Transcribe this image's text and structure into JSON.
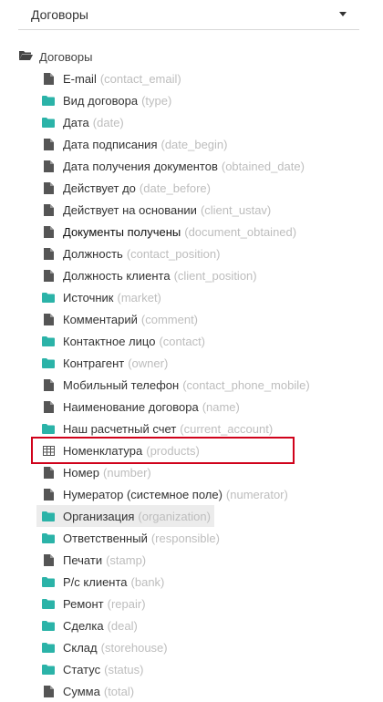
{
  "select": {
    "value": "Договоры"
  },
  "root": {
    "label": "Договоры",
    "icon": "folder-open-icon"
  },
  "items": [
    {
      "label": "E-mail",
      "code": "(contact_email)",
      "icon": "file-icon"
    },
    {
      "label": "Вид договора",
      "code": "(type)",
      "icon": "folder-icon"
    },
    {
      "label": "Дата",
      "code": "(date)",
      "icon": "folder-icon"
    },
    {
      "label": "Дата подписания",
      "code": "(date_begin)",
      "icon": "file-icon"
    },
    {
      "label": "Дата получения документов",
      "code": "(obtained_date)",
      "icon": "file-icon"
    },
    {
      "label": "Действует до",
      "code": "(date_before)",
      "icon": "file-icon"
    },
    {
      "label": "Действует на основании",
      "code": "(client_ustav)",
      "icon": "file-icon"
    },
    {
      "label": "Документы получены",
      "code": "(document_obtained)",
      "icon": "file-icon"
    },
    {
      "label": "Должность",
      "code": "(contact_position)",
      "icon": "file-icon"
    },
    {
      "label": "Должность клиента",
      "code": "(client_position)",
      "icon": "file-icon"
    },
    {
      "label": "Источник",
      "code": "(market)",
      "icon": "folder-icon"
    },
    {
      "label": "Комментарий",
      "code": "(comment)",
      "icon": "file-icon"
    },
    {
      "label": "Контактное лицо",
      "code": "(contact)",
      "icon": "folder-icon"
    },
    {
      "label": "Контрагент",
      "code": "(owner)",
      "icon": "folder-icon"
    },
    {
      "label": "Мобильный телефон",
      "code": "(contact_phone_mobile)",
      "icon": "file-icon"
    },
    {
      "label": "Наименование договора",
      "code": "(name)",
      "icon": "file-icon"
    },
    {
      "label": "Наш расчетный счет",
      "code": "(current_account)",
      "icon": "folder-icon"
    },
    {
      "label": "Номенклатура",
      "code": "(products)",
      "icon": "table-icon"
    },
    {
      "label": "Номер",
      "code": "(number)",
      "icon": "file-icon"
    },
    {
      "label": "Нумератор (системное поле)",
      "code": "(numerator)",
      "icon": "file-icon"
    },
    {
      "label": "Организация",
      "code": "(organization)",
      "icon": "folder-icon"
    },
    {
      "label": "Ответственный",
      "code": "(responsible)",
      "icon": "folder-icon"
    },
    {
      "label": "Печати",
      "code": "(stamp)",
      "icon": "file-icon"
    },
    {
      "label": "Р/с клиента",
      "code": "(bank)",
      "icon": "folder-icon"
    },
    {
      "label": "Ремонт",
      "code": "(repair)",
      "icon": "folder-icon"
    },
    {
      "label": "Сделка",
      "code": "(deal)",
      "icon": "folder-icon"
    },
    {
      "label": "Склад",
      "code": "(storehouse)",
      "icon": "folder-icon"
    },
    {
      "label": "Статус",
      "code": "(status)",
      "icon": "folder-icon"
    },
    {
      "label": "Сумма",
      "code": "(total)",
      "icon": "file-icon"
    }
  ],
  "selected_item": "Организация",
  "highlighted_item": "Номенклатура",
  "bold_item": "Документы получены",
  "colors": {
    "folder": "#2bb3a8",
    "file": "#555555",
    "highlight": "#d0021b"
  }
}
